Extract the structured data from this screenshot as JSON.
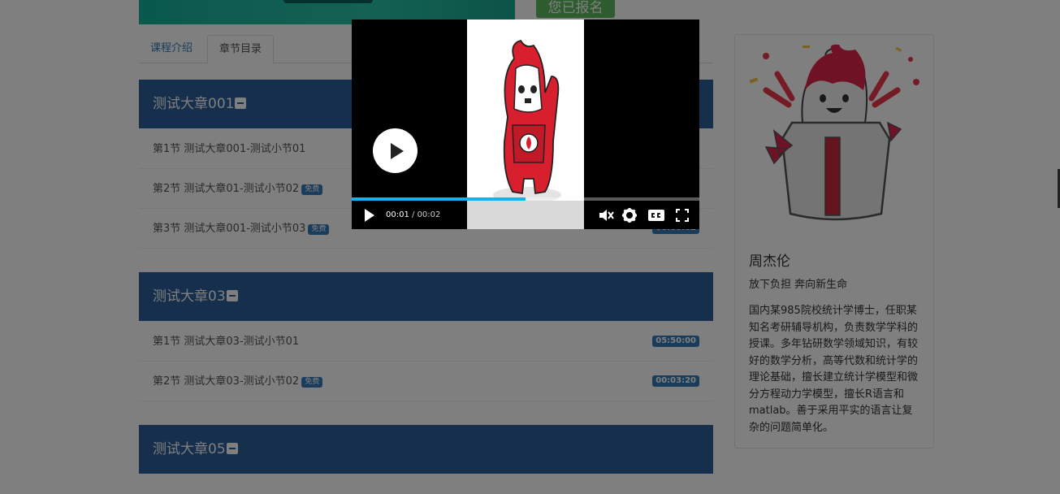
{
  "enroll": {
    "label": "您已报名"
  },
  "tabs": [
    {
      "label": "课程介绍"
    },
    {
      "label": "章节目录"
    }
  ],
  "chapters": [
    {
      "title": "测试大章001",
      "lessons": [
        {
          "title": "第1节 测试大章001-测试小节01",
          "free": "",
          "duration": ""
        },
        {
          "title": "第2节 测试大章01-测试小节02",
          "free": "免费",
          "duration": ""
        },
        {
          "title": "第3节 测试大章001-测试小节03",
          "free": "免费",
          "duration": "00:00:02"
        }
      ]
    },
    {
      "title": "测试大章03",
      "lessons": [
        {
          "title": "第1节 测试大章03-测试小节01",
          "free": "",
          "duration": "05:50:00"
        },
        {
          "title": "第2节 测试大章03-测试小节02",
          "free": "免费",
          "duration": "00:03:20"
        }
      ]
    },
    {
      "title": "测试大章05",
      "lessons": []
    }
  ],
  "teacher": {
    "name": "周杰伦",
    "motto": "放下负担 奔向新生命",
    "bio": "国内某985院校统计学博士，任职某知名考研辅导机构，负责数学学科的授课。多年钻研数学领域知识，有较好的数学分析，高等代数和统计学的理论基础，擅长建立统计学模型和微分方程动力学模型，擅长R语言和matlab。善于采用平实的语言让复杂的问题简单化。"
  },
  "player": {
    "current_time": "00:01",
    "separator": " / ",
    "duration": "00:02",
    "progress": 0.5,
    "accent_color": "#17b3e8",
    "icons": [
      "play-icon",
      "volume-muted-icon",
      "settings-gear-icon",
      "captions-icon",
      "fullscreen-icon"
    ]
  },
  "colors": {
    "chapter_header": "#2a5e9b",
    "badge": "#337ab7",
    "banner": "#1fb89e",
    "enrolled": "#5cb85c"
  }
}
